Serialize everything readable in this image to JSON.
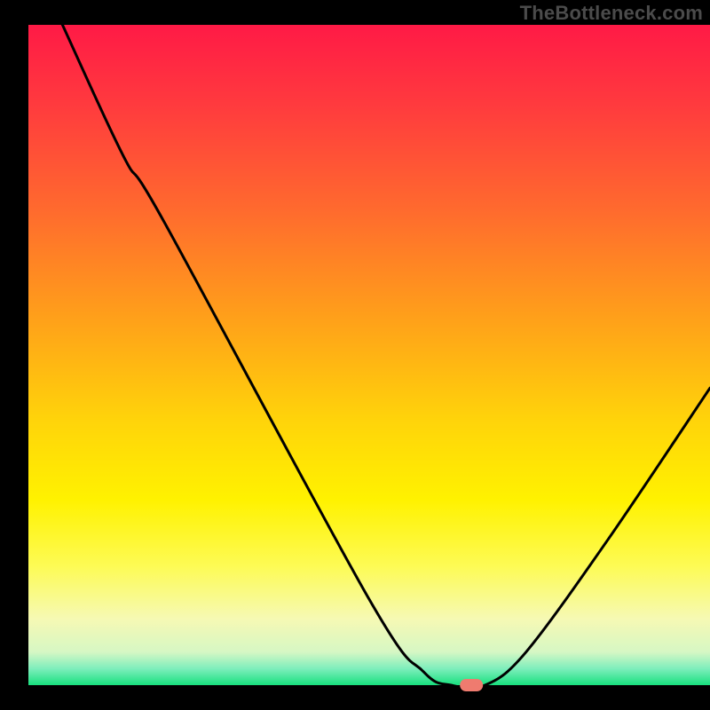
{
  "watermark": "TheBottleneck.com",
  "colors": {
    "frame": "#000000",
    "curve": "#000000",
    "marker_fill": "#ef7b6f",
    "gradient_stops": [
      {
        "offset": 0.0,
        "color": "#ff1a46"
      },
      {
        "offset": 0.12,
        "color": "#ff3a3e"
      },
      {
        "offset": 0.28,
        "color": "#ff6a2e"
      },
      {
        "offset": 0.45,
        "color": "#ffa219"
      },
      {
        "offset": 0.6,
        "color": "#ffd40a"
      },
      {
        "offset": 0.72,
        "color": "#fff200"
      },
      {
        "offset": 0.82,
        "color": "#fdfb55"
      },
      {
        "offset": 0.9,
        "color": "#f6f9b4"
      },
      {
        "offset": 0.95,
        "color": "#d6f7c4"
      },
      {
        "offset": 0.975,
        "color": "#7eeebc"
      },
      {
        "offset": 1.0,
        "color": "#18e07e"
      }
    ]
  },
  "chart_data": {
    "type": "line",
    "title": "",
    "xlabel": "",
    "ylabel": "",
    "xlim": [
      0,
      100
    ],
    "ylim": [
      0,
      100
    ],
    "grid": false,
    "legend": false,
    "series": [
      {
        "name": "bottleneck-curve",
        "points": [
          {
            "x": 5,
            "y": 100
          },
          {
            "x": 14,
            "y": 80
          },
          {
            "x": 20,
            "y": 70
          },
          {
            "x": 50,
            "y": 13
          },
          {
            "x": 58,
            "y": 2
          },
          {
            "x": 62,
            "y": 0
          },
          {
            "x": 67,
            "y": 0
          },
          {
            "x": 73,
            "y": 5
          },
          {
            "x": 85,
            "y": 22
          },
          {
            "x": 100,
            "y": 45
          }
        ]
      }
    ],
    "markers": [
      {
        "name": "optimal-point",
        "x": 65,
        "y": 0
      }
    ]
  }
}
